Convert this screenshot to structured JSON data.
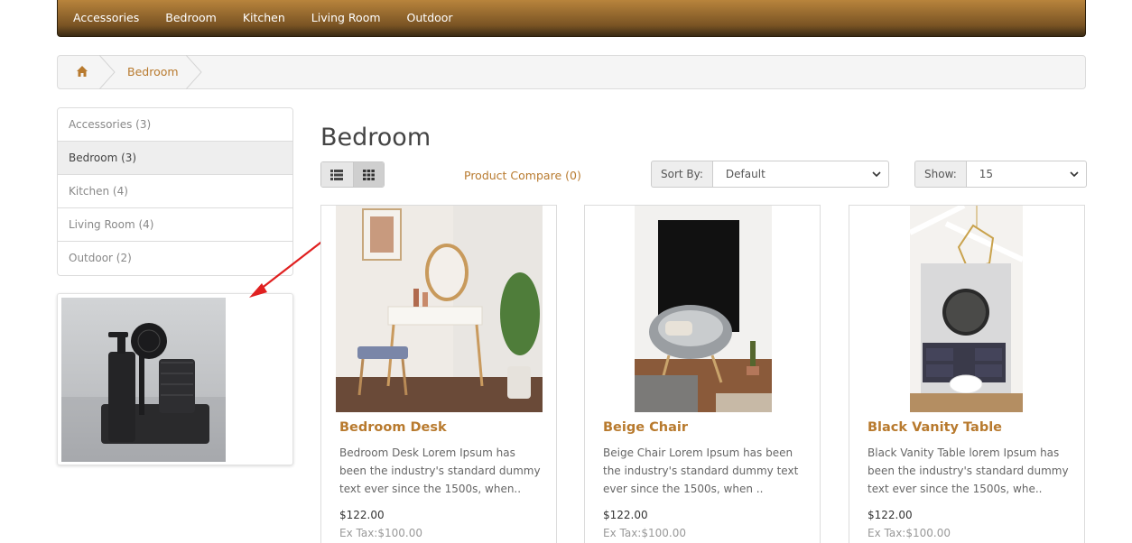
{
  "nav": {
    "items": [
      "Accessories",
      "Bedroom",
      "Kitchen",
      "Living Room",
      "Outdoor"
    ]
  },
  "breadcrumb": {
    "home_icon": "home-icon",
    "current": "Bedroom"
  },
  "sidebar": {
    "categories": [
      {
        "label": "Accessories (3)",
        "active": false
      },
      {
        "label": "Bedroom (3)",
        "active": true
      },
      {
        "label": "Kitchen (4)",
        "active": false
      },
      {
        "label": "Living Room (4)",
        "active": false
      },
      {
        "label": "Outdoor (2)",
        "active": false
      }
    ]
  },
  "page": {
    "title": "Bedroom"
  },
  "toolbar": {
    "list_icon": "list-view-icon",
    "grid_icon": "grid-view-icon",
    "compare": "Product Compare (0)",
    "sort_label": "Sort By:",
    "sort_value": "Default",
    "show_label": "Show:",
    "show_value": "15"
  },
  "products": [
    {
      "name": "Bedroom Desk",
      "desc": "Bedroom Desk Lorem Ipsum has been the industry's standard dummy text ever since the 1500s, when..",
      "price": "$122.00",
      "tax": "Ex Tax:$100.00"
    },
    {
      "name": "Beige Chair",
      "desc": "Beige Chair Lorem Ipsum has been the industry's standard dummy text ever since the 1500s, when ..",
      "price": "$122.00",
      "tax": "Ex Tax:$100.00"
    },
    {
      "name": "Black Vanity Table",
      "desc": "Black Vanity Table lorem Ipsum has been the industry's standard dummy text ever since the 1500s, whe..",
      "price": "$122.00",
      "tax": "Ex Tax:$100.00"
    }
  ],
  "colors": {
    "accent": "#b87a2e",
    "nav": "#8a5f2a",
    "arrow": "#e02020"
  }
}
